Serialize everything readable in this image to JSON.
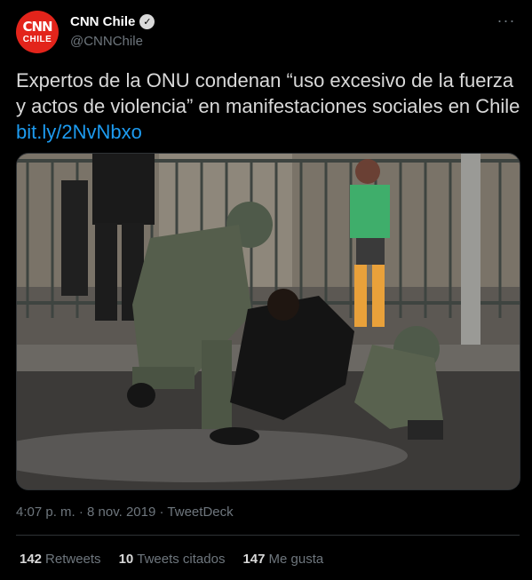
{
  "account": {
    "display_name": "CNN Chile",
    "handle": "@CNNChile",
    "avatar_text_top": "CNN",
    "avatar_text_bottom": "CHILE",
    "verified_icon": "verified-badge-icon"
  },
  "menu": {
    "more_glyph": "···"
  },
  "tweet": {
    "text": "Expertos de la ONU condenan “uso excesivo de la fuerza y actos de violencia” en manifestaciones sociales en Chile ",
    "link": "bit.ly/2NvNbxo"
  },
  "meta": {
    "time": "4:07 p. m.",
    "separator_1": "·",
    "date": "8 nov. 2019",
    "separator_2": "·",
    "source": "TweetDeck"
  },
  "stats": {
    "retweets_count": "142",
    "retweets_label": "Retweets",
    "quotes_count": "10",
    "quotes_label": "Tweets citados",
    "likes_count": "147",
    "likes_label": "Me gusta"
  },
  "colors": {
    "background": "#000000",
    "link": "#1d9bf0",
    "muted": "#6e767d",
    "brand_red": "#e3241b"
  }
}
